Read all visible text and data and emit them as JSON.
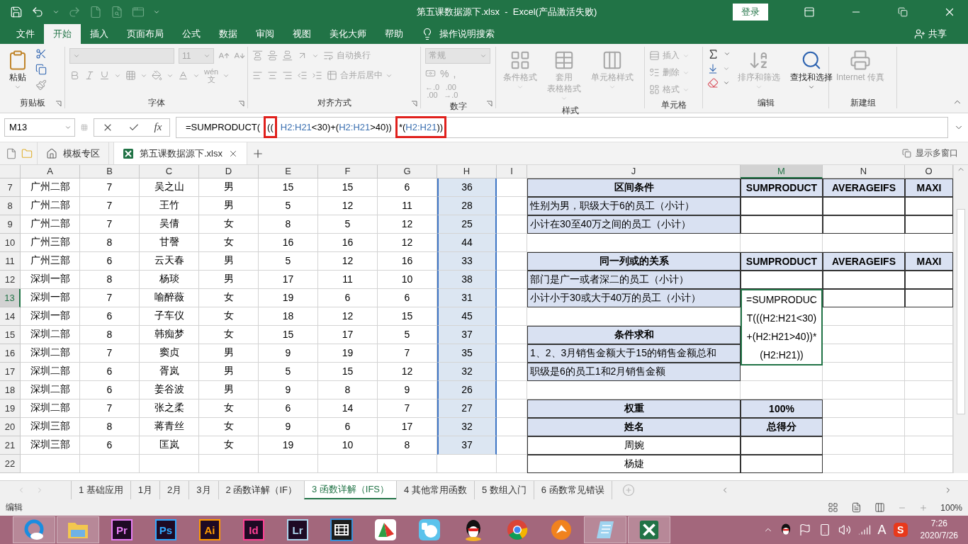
{
  "window": {
    "title": "第五课数据源下.xlsx  -  Excel(产品激活失败)",
    "signin": "登录"
  },
  "ribbon_tabs": [
    {
      "label": "文件",
      "selected": false
    },
    {
      "label": "开始",
      "selected": true
    },
    {
      "label": "插入",
      "selected": false
    },
    {
      "label": "页面布局",
      "selected": false
    },
    {
      "label": "公式",
      "selected": false
    },
    {
      "label": "数据",
      "selected": false
    },
    {
      "label": "审阅",
      "selected": false
    },
    {
      "label": "视图",
      "selected": false
    },
    {
      "label": "美化大师",
      "selected": false
    },
    {
      "label": "帮助",
      "selected": false
    }
  ],
  "tell_me": "操作说明搜索",
  "share": "共享",
  "ribbon_groups": [
    {
      "kind": "clipboard",
      "title": "剪贴板",
      "buttons": [
        {
          "label": "粘贴",
          "disabled": false
        }
      ]
    },
    {
      "kind": "font",
      "title": "字体",
      "size": "11",
      "phonetic": [
        "wén",
        "文"
      ]
    },
    {
      "kind": "alignment",
      "title": "对齐方式",
      "buttons": [
        {
          "label": "自动换行",
          "disabled": true
        },
        {
          "label": "合并后居中",
          "disabled": true
        }
      ]
    },
    {
      "kind": "number",
      "title": "数字",
      "format": "常规",
      "symbols": [
        "%",
        ","
      ],
      "decimals": [
        "←.0",
        ".00",
        ".00",
        "→.0"
      ]
    },
    {
      "kind": "styles",
      "title": "样式",
      "buttons": [
        {
          "label": "条件格式",
          "disabled": true
        },
        {
          "label": "套用",
          "label2": "表格格式",
          "disabled": true
        },
        {
          "label": "单元格样式",
          "disabled": true
        }
      ]
    },
    {
      "kind": "cells",
      "title": "单元格",
      "buttons": [
        {
          "label": "插入",
          "disabled": true
        },
        {
          "label": "删除",
          "disabled": true
        },
        {
          "label": "格式",
          "disabled": true
        }
      ]
    },
    {
      "kind": "editing",
      "title": "编辑",
      "buttons": [
        {
          "label": "排序和筛选",
          "disabled": true
        },
        {
          "label": "查找和选择",
          "disabled": false
        }
      ]
    },
    {
      "kind": "custom",
      "title": "新建组",
      "buttons": [
        {
          "label": "Internet 传真",
          "disabled": true
        }
      ]
    }
  ],
  "formula_bar": {
    "name_box": "M13",
    "fx": "fx",
    "segments": [
      {
        "boxed": false,
        "parts": [
          {
            "text": "=SUMPRODUCT(",
            "color": "#000000"
          }
        ]
      },
      {
        "boxed": true,
        "parts": [
          {
            "text": "((",
            "color": "#000000"
          }
        ]
      },
      {
        "boxed": false,
        "parts": [
          {
            "text": "H2:H21",
            "color": "#3a6fb0"
          },
          {
            "text": "<30)+(",
            "color": "#000000"
          },
          {
            "text": "H2:H21",
            "color": "#3a6fb0"
          },
          {
            "text": ">40))",
            "color": "#000000"
          }
        ]
      },
      {
        "boxed": true,
        "parts": [
          {
            "text": "*(",
            "color": "#000000"
          },
          {
            "text": "H2:H21",
            "color": "#3a6fb0"
          },
          {
            "text": "))",
            "color": "#000000"
          }
        ]
      }
    ]
  },
  "workbook_tabs": [
    {
      "kind": "home",
      "label": "模板专区",
      "selected": false
    },
    {
      "kind": "excel",
      "label": "第五课数据源下.xlsx",
      "selected": true
    }
  ],
  "multi_window": "显示多窗口",
  "columns": [
    {
      "label": "A",
      "selected": false
    },
    {
      "label": "B",
      "selected": false
    },
    {
      "label": "C",
      "selected": false
    },
    {
      "label": "D",
      "selected": false
    },
    {
      "label": "E",
      "selected": false
    },
    {
      "label": "F",
      "selected": false
    },
    {
      "label": "G",
      "selected": false
    },
    {
      "label": "H",
      "selected": false
    },
    {
      "label": "I",
      "selected": false
    },
    {
      "label": "J",
      "selected": false
    },
    {
      "label": "M",
      "selected": true
    },
    {
      "label": "N",
      "selected": false
    },
    {
      "label": "O",
      "selected": false
    }
  ],
  "rows": [
    {
      "number": "7",
      "selected": false,
      "referenced": true,
      "cells": [
        "广州二部",
        "7",
        "吴之山",
        "男",
        "15",
        "15",
        "6",
        "36"
      ],
      "side": [
        {
          "kind": "header",
          "text": "区间条件"
        },
        {
          "kind": "header",
          "text": "SUMPRODUCT"
        },
        {
          "kind": "header",
          "text": "AVERAGEIFS"
        },
        {
          "kind": "header",
          "text": "MAXI"
        }
      ]
    },
    {
      "number": "8",
      "selected": false,
      "referenced": true,
      "cells": [
        "广州二部",
        "7",
        "王竹",
        "男",
        "5",
        "12",
        "11",
        "28"
      ],
      "side": [
        {
          "kind": "label",
          "text": "性别为男，职级大于6的员工（小计）"
        },
        {
          "kind": "input"
        },
        {
          "kind": "input"
        },
        {
          "kind": "input"
        }
      ]
    },
    {
      "number": "9",
      "selected": false,
      "referenced": true,
      "cells": [
        "广州二部",
        "7",
        "吴倩",
        "女",
        "8",
        "5",
        "12",
        "25"
      ],
      "side": [
        {
          "kind": "label",
          "text": "小计在30至40万之间的员工（小计）"
        },
        {
          "kind": "input"
        },
        {
          "kind": "input"
        },
        {
          "kind": "input"
        }
      ]
    },
    {
      "number": "10",
      "selected": false,
      "referenced": true,
      "cells": [
        "广州三部",
        "8",
        "甘謦",
        "女",
        "16",
        "16",
        "12",
        "44"
      ],
      "side": [
        {
          "kind": "blank"
        },
        {
          "kind": "blank"
        },
        {
          "kind": "blank"
        },
        {
          "kind": "blank"
        }
      ]
    },
    {
      "number": "11",
      "selected": false,
      "referenced": true,
      "cells": [
        "广州三部",
        "6",
        "云天春",
        "男",
        "5",
        "12",
        "16",
        "33"
      ],
      "side": [
        {
          "kind": "header",
          "text": "同一列或的关系"
        },
        {
          "kind": "header",
          "text": "SUMPRODUCT"
        },
        {
          "kind": "header",
          "text": "AVERAGEIFS"
        },
        {
          "kind": "header",
          "text": "MAXI"
        }
      ]
    },
    {
      "number": "12",
      "selected": false,
      "referenced": true,
      "cells": [
        "深圳一部",
        "8",
        "杨琰",
        "男",
        "17",
        "11",
        "10",
        "38"
      ],
      "side": [
        {
          "kind": "label",
          "text": "部门是广一或者深二的员工（小计）"
        },
        {
          "kind": "input"
        },
        {
          "kind": "input"
        },
        {
          "kind": "input"
        }
      ]
    },
    {
      "number": "13",
      "selected": true,
      "referenced": true,
      "cells": [
        "深圳一部",
        "7",
        "喻醉薇",
        "女",
        "19",
        "6",
        "6",
        "31"
      ],
      "side": [
        {
          "kind": "label",
          "text": "小计小于30或大于40万的员工（小计）"
        },
        {
          "kind": "editing",
          "text": "=SUMPRODUCT(((H2:H21<30)+(H2:H21>40))*(H2:H21))"
        },
        {
          "kind": "input"
        },
        {
          "kind": "input"
        }
      ]
    },
    {
      "number": "14",
      "selected": false,
      "referenced": true,
      "cells": [
        "深圳一部",
        "6",
        "子车仪",
        "女",
        "18",
        "12",
        "15",
        "45"
      ],
      "side": [
        {
          "kind": "blank"
        },
        {
          "kind": "covered"
        },
        {
          "kind": "blank"
        },
        {
          "kind": "blank"
        }
      ]
    },
    {
      "number": "15",
      "selected": false,
      "referenced": true,
      "cells": [
        "深圳二部",
        "8",
        "韩痴梦",
        "女",
        "15",
        "17",
        "5",
        "37"
      ],
      "side": [
        {
          "kind": "header",
          "text": "条件求和"
        },
        {
          "kind": "covered"
        },
        {
          "kind": "blank"
        },
        {
          "kind": "blank"
        }
      ]
    },
    {
      "number": "16",
      "selected": false,
      "referenced": true,
      "cells": [
        "深圳二部",
        "7",
        "窦贞",
        "男",
        "9",
        "19",
        "7",
        "35"
      ],
      "side": [
        {
          "kind": "label",
          "text": "1、2、3月销售金额大于15的销售金额总和"
        },
        {
          "kind": "covered"
        },
        {
          "kind": "blank"
        },
        {
          "kind": "blank"
        }
      ]
    },
    {
      "number": "17",
      "selected": false,
      "referenced": true,
      "cells": [
        "深圳二部",
        "6",
        "胥岚",
        "男",
        "5",
        "15",
        "12",
        "32"
      ],
      "side": [
        {
          "kind": "label",
          "text": "职级是6的员工1和2月销售金额"
        },
        {
          "kind": "blank"
        },
        {
          "kind": "blank"
        },
        {
          "kind": "blank"
        }
      ]
    },
    {
      "number": "18",
      "selected": false,
      "referenced": true,
      "cells": [
        "深圳二部",
        "6",
        "姜谷波",
        "男",
        "9",
        "8",
        "9",
        "26"
      ],
      "side": [
        {
          "kind": "blank"
        },
        {
          "kind": "blank"
        },
        {
          "kind": "blank"
        },
        {
          "kind": "blank"
        }
      ]
    },
    {
      "number": "19",
      "selected": false,
      "referenced": true,
      "cells": [
        "深圳二部",
        "7",
        "张之柔",
        "女",
        "6",
        "14",
        "7",
        "27"
      ],
      "side": [
        {
          "kind": "header",
          "text": "权重"
        },
        {
          "kind": "header",
          "text": "100%"
        },
        {
          "kind": "blank"
        },
        {
          "kind": "blank"
        }
      ]
    },
    {
      "number": "20",
      "selected": false,
      "referenced": true,
      "cells": [
        "深圳三部",
        "8",
        "蒋青丝",
        "女",
        "9",
        "6",
        "17",
        "32"
      ],
      "side": [
        {
          "kind": "header",
          "text": "姓名"
        },
        {
          "kind": "header",
          "text": "总得分"
        },
        {
          "kind": "blank"
        },
        {
          "kind": "blank"
        }
      ]
    },
    {
      "number": "21",
      "selected": false,
      "referenced": true,
      "cells": [
        "深圳三部",
        "6",
        "匡岚",
        "女",
        "19",
        "10",
        "8",
        "37"
      ],
      "side": [
        {
          "kind": "name",
          "text": "周婉"
        },
        {
          "kind": "input"
        },
        {
          "kind": "blank"
        },
        {
          "kind": "blank"
        }
      ]
    },
    {
      "number": "22",
      "selected": false,
      "referenced": false,
      "cells": [],
      "side": [
        {
          "kind": "name",
          "text": "杨婕"
        },
        {
          "kind": "input"
        },
        {
          "kind": "blank"
        },
        {
          "kind": "blank"
        }
      ]
    }
  ],
  "sheet_tabs": [
    {
      "label": "1 基础应用",
      "selected": false
    },
    {
      "label": "1月",
      "selected": false
    },
    {
      "label": "2月",
      "selected": false
    },
    {
      "label": "3月",
      "selected": false
    },
    {
      "label": "2 函数详解（IF）",
      "selected": false
    },
    {
      "label": "3 函数详解（IFS）",
      "selected": true
    },
    {
      "label": "4 其他常用函数",
      "selected": false
    },
    {
      "label": "5 数组入门",
      "selected": false
    },
    {
      "label": "6 函数常见错误",
      "selected": false
    }
  ],
  "status_bar": {
    "mode": "编辑",
    "zoom": "100%"
  },
  "taskbar": {
    "apps": [
      {
        "kind": "browser",
        "running": true
      },
      {
        "kind": "folder",
        "running": true
      },
      {
        "kind": "letters",
        "text": "Pr",
        "color": "#e77df5",
        "running": false
      },
      {
        "kind": "letters",
        "text": "Ps",
        "color": "#31a8ff",
        "running": false
      },
      {
        "kind": "letters",
        "text": "Ai",
        "color": "#ff9a00",
        "running": false
      },
      {
        "kind": "letters",
        "text": "Id",
        "color": "#ff3f94",
        "running": false
      },
      {
        "kind": "letters",
        "text": "Lr",
        "color": "#add5ec",
        "running": false
      },
      {
        "kind": "film",
        "running": false
      },
      {
        "kind": "chart",
        "running": false
      },
      {
        "kind": "cartoon",
        "running": false
      },
      {
        "kind": "penguin",
        "running": false
      },
      {
        "kind": "chrome",
        "running": false
      },
      {
        "kind": "fox",
        "running": false
      },
      {
        "kind": "notepad",
        "running": true
      },
      {
        "kind": "excel",
        "running": true
      }
    ],
    "tray": [
      {
        "kind": "chevron"
      },
      {
        "kind": "penguin"
      },
      {
        "kind": "flag"
      },
      {
        "kind": "device"
      },
      {
        "kind": "volume"
      },
      {
        "kind": "signal"
      },
      {
        "kind": "text",
        "text": "A"
      },
      {
        "kind": "ime",
        "text": "S"
      }
    ],
    "time": "7:26",
    "date": "2020/7/26"
  }
}
